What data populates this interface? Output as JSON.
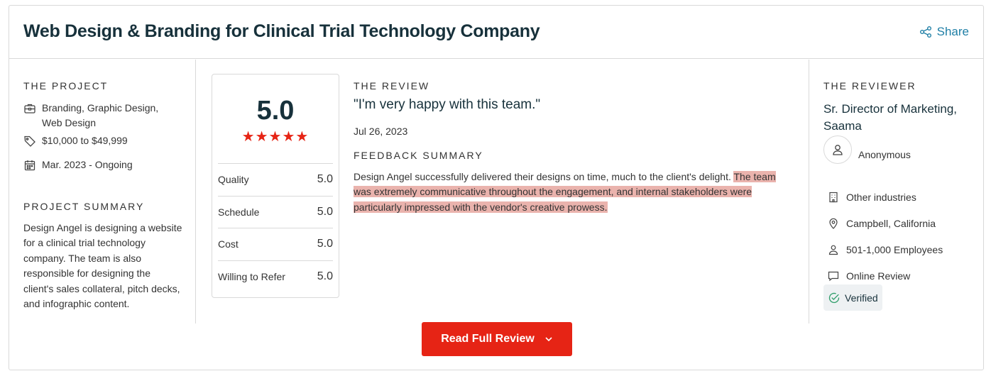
{
  "header": {
    "title": "Web Design & Branding for Clinical Trial Technology Company",
    "share_label": "Share"
  },
  "project": {
    "section_label": "THE PROJECT",
    "services": "Branding, Graphic Design, Web Design",
    "budget": "$10,000 to $49,999",
    "timeline": "Mar. 2023 - Ongoing",
    "summary_label": "PROJECT SUMMARY",
    "summary": "Design Angel is designing a website for a clinical trial technology company. The team is also responsible for designing the client's sales collateral, pitch decks, and infographic content."
  },
  "ratings": {
    "overall": "5.0",
    "stars": "★★★★★",
    "star_count": 5,
    "metrics": [
      {
        "label": "Quality",
        "value": "5.0"
      },
      {
        "label": "Schedule",
        "value": "5.0"
      },
      {
        "label": "Cost",
        "value": "5.0"
      },
      {
        "label": "Willing to Refer",
        "value": "5.0"
      }
    ]
  },
  "review": {
    "section_label": "THE REVIEW",
    "quote": "\"I'm very happy with this team.\"",
    "date": "Jul 26, 2023",
    "feedback_label": "FEEDBACK SUMMARY",
    "feedback_plain": "Design Angel successfully delivered their designs on time, much to the client's delight. ",
    "feedback_highlight": "The team was extremely communicative throughout the engagement, and internal stakeholders were particularly impressed with the vendor's creative prowess. "
  },
  "reviewer": {
    "section_label": "THE REVIEWER",
    "role": "Sr. Director of Marketing, Saama",
    "name": "Anonymous",
    "industry": "Other industries",
    "location": "Campbell, California",
    "size": "501-1,000 Employees",
    "review_type": "Online Review",
    "verified": "Verified"
  },
  "actions": {
    "read_full_review": "Read Full Review"
  },
  "colors": {
    "accent_red": "#e62415",
    "title_dark": "#17313b",
    "link_blue": "#1f7fa6",
    "highlight": "#eab3ad"
  },
  "icons": {
    "share": "share-icon",
    "briefcase": "briefcase-icon",
    "tag": "tag-icon",
    "calendar": "calendar-icon",
    "user": "user-icon",
    "building": "building-icon",
    "location": "location-pin-icon",
    "employees": "person-icon",
    "review": "chat-bubble-icon",
    "verified": "check-circle-icon",
    "chevron": "chevron-down-icon"
  }
}
